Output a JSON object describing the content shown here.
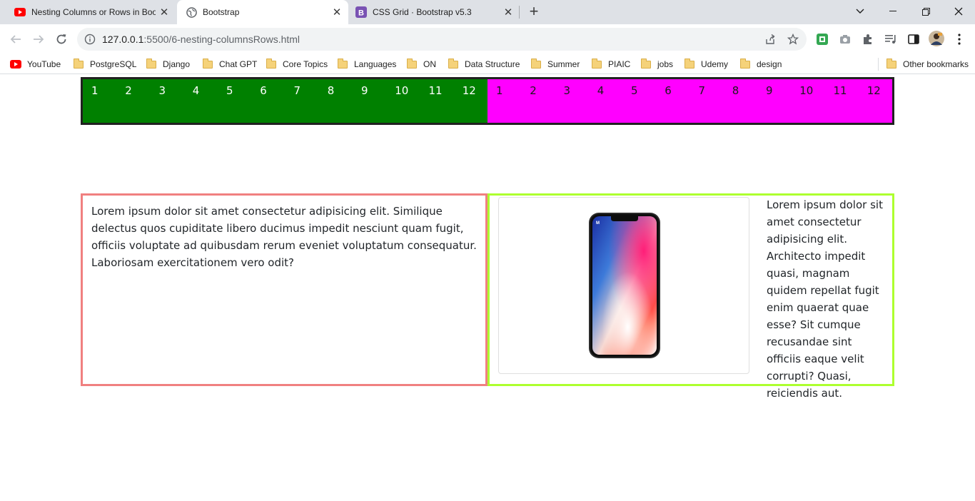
{
  "browser": {
    "tabs": [
      {
        "title": "Nesting Columns or Rows in Boo",
        "icon": "youtube-icon",
        "active": false
      },
      {
        "title": "Bootstrap",
        "icon": "globe-icon",
        "active": true
      },
      {
        "title": "CSS Grid · Bootstrap v5.3",
        "icon": "bootstrap-icon",
        "active": false
      }
    ],
    "new_tab_glyph": "+",
    "url": {
      "host": "127.0.0.1",
      "path": ":5500/6-nesting-columnsRows.html"
    },
    "bookmarks": [
      {
        "label": "YouTube",
        "icon": "youtube-icon"
      },
      {
        "label": "PostgreSQL",
        "icon": "folder-icon"
      },
      {
        "label": "Django",
        "icon": "folder-icon"
      },
      {
        "label": "Chat GPT",
        "icon": "folder-icon"
      },
      {
        "label": "Core Topics",
        "icon": "folder-icon"
      },
      {
        "label": "Languages",
        "icon": "folder-icon"
      },
      {
        "label": "ON",
        "icon": "folder-icon"
      },
      {
        "label": "Data Structure",
        "icon": "folder-icon"
      },
      {
        "label": "Summer",
        "icon": "folder-icon"
      },
      {
        "label": "PIAIC",
        "icon": "folder-icon"
      },
      {
        "label": "jobs",
        "icon": "folder-icon"
      },
      {
        "label": "Udemy",
        "icon": "folder-icon"
      },
      {
        "label": "design",
        "icon": "folder-icon"
      }
    ],
    "other_bookmarks": "Other bookmarks"
  },
  "page": {
    "grid_left": {
      "color": "#008000",
      "cells": [
        "1",
        "2",
        "3",
        "4",
        "5",
        "6",
        "7",
        "8",
        "9",
        "10",
        "11",
        "12"
      ]
    },
    "grid_right": {
      "color": "#ff00ff",
      "cells": [
        "1",
        "2",
        "3",
        "4",
        "5",
        "6",
        "7",
        "8",
        "9",
        "10",
        "11",
        "12"
      ]
    },
    "left_box": {
      "border_color": "#f08080",
      "text": "Lorem ipsum dolor sit amet consectetur adipisicing elit. Similique delectus quos cupiditate libero ducimus impedit nesciunt quam fugit, officiis voluptate ad quibusdam rerum eveniet voluptatum consequatur. Laboriosam exercitationem vero odit?"
    },
    "right_box": {
      "border_color": "#adff2f",
      "image": "iphone-x-image",
      "text": "Lorem ipsum dolor sit amet consectetur adipisicing elit. Architecto impedit quasi, magnam quidem repellat fugit enim quaerat quae esse? Sit cumque recusandae sint officiis eaque velit corrupti? Quasi, reiciendis aut."
    }
  }
}
